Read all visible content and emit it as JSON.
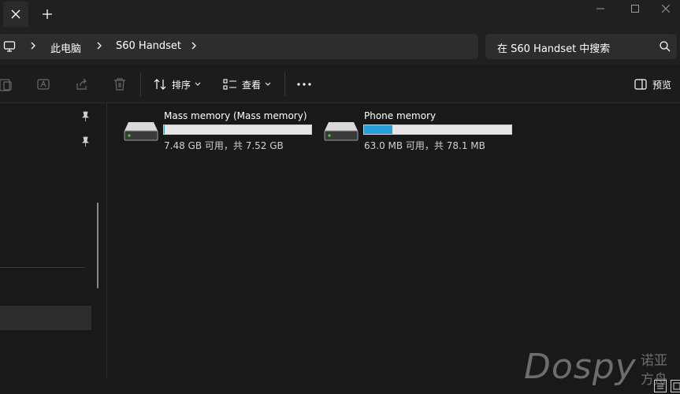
{
  "window": {
    "tab_close_icon": "close-icon",
    "new_tab_icon": "plus-icon",
    "controls": [
      "minimize-icon",
      "maximize-icon",
      "close-icon"
    ]
  },
  "address": {
    "root_icon": "monitor-icon",
    "crumbs": [
      "此电脑",
      "S60 Handset"
    ]
  },
  "search": {
    "placeholder": "在 S60 Handset 中搜索",
    "icon": "search-icon"
  },
  "toolbar": {
    "sort_label": "排序",
    "view_label": "查看",
    "details_label": "预览",
    "more_icon": "ellipsis-icon"
  },
  "drives": [
    {
      "name": "Mass memory (Mass memory)",
      "info": "7.48 GB 可用，共 7.52 GB",
      "used_fraction": 0.005
    },
    {
      "name": "Phone memory",
      "info": "63.0 MB 可用，共 78.1 MB",
      "used_fraction": 0.193
    }
  ],
  "watermark": {
    "latin": "Dospy",
    "cjk": "诺亚方舟"
  },
  "colors": {
    "accent": "#26a0da",
    "background": "#191919",
    "chrome": "#202020"
  }
}
